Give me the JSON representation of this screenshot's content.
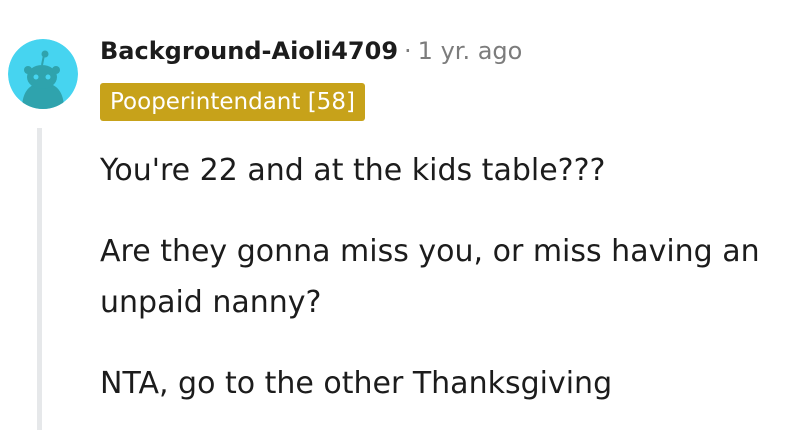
{
  "comment": {
    "author": "Background-Aioli4709",
    "separator": "·",
    "timestamp": "1 yr. ago",
    "flair": "Pooperintendant [58]",
    "paragraphs": [
      "You're 22 and at the kids table???",
      "Are they gonna miss you, or miss having an unpaid nanny?",
      "NTA, go to the other Thanksgiving"
    ]
  },
  "avatar": {
    "icon": "snoo-avatar-icon",
    "background_color": "#46d4f0",
    "figure_color": "#2fa3ad"
  },
  "colors": {
    "flair_background": "#c7a21a",
    "username": "#1c1c1c",
    "meta_text": "#7c7c7c",
    "thread_line": "#e6e8ea"
  }
}
